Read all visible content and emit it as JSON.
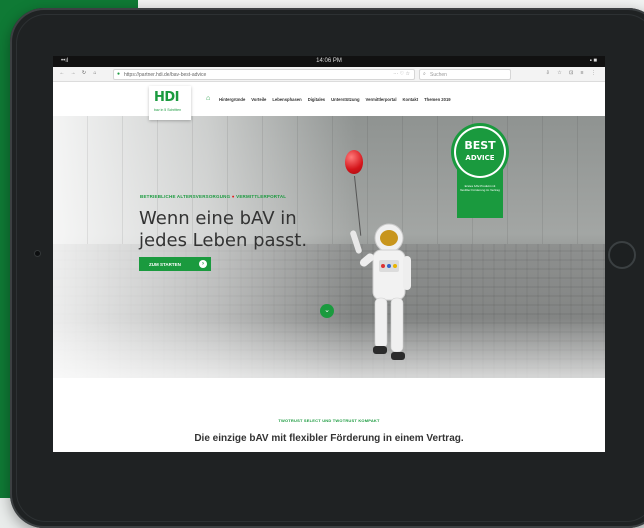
{
  "device": {
    "status_time": "14:06 PM",
    "signal": "••ıl",
    "battery": "▪ ■"
  },
  "browser": {
    "url": "https://partner.hdi.de/bav-best-advice",
    "search_placeholder": "Suchen",
    "nav_icons": [
      "←",
      "→",
      "↻",
      "⌂"
    ],
    "toolbar_icons": "⇩ ☆ ⊡ ≡ ⋮"
  },
  "site": {
    "logo_text": "HDI",
    "logo_tagline": "bav in 5 Schritten",
    "nav_items": [
      "Hintergründe",
      "Vorteile",
      "Lebensphasen",
      "Digitales",
      "Unterstützung",
      "Vermittlerportal",
      "Kontakt",
      "Themen 2019"
    ]
  },
  "hero": {
    "kicker_left": "BETRIEBLICHE ALTERSVERSORGUNG",
    "kicker_right": "VERMITTLERPORTAL",
    "headline_line1": "Wenn eine bAV in",
    "headline_line2": "jedes Leben passt.",
    "cta_label": "ZUM STARTEN",
    "badge_line1": "BEST",
    "badge_line2": "ADVICE",
    "badge_small": "Erstes bAV-Produkt mit flexibler Förderung im Vertrag"
  },
  "section": {
    "kicker": "TWOTRUST SELECT UND TWOTRUST KOMPAKT",
    "title": "Die einzige bAV mit flexibler Förderung in einem Vertrag."
  },
  "colors": {
    "brand_green": "#1a9a3e",
    "side_green": "#0f7a35",
    "balloon_red": "#d4141a"
  }
}
